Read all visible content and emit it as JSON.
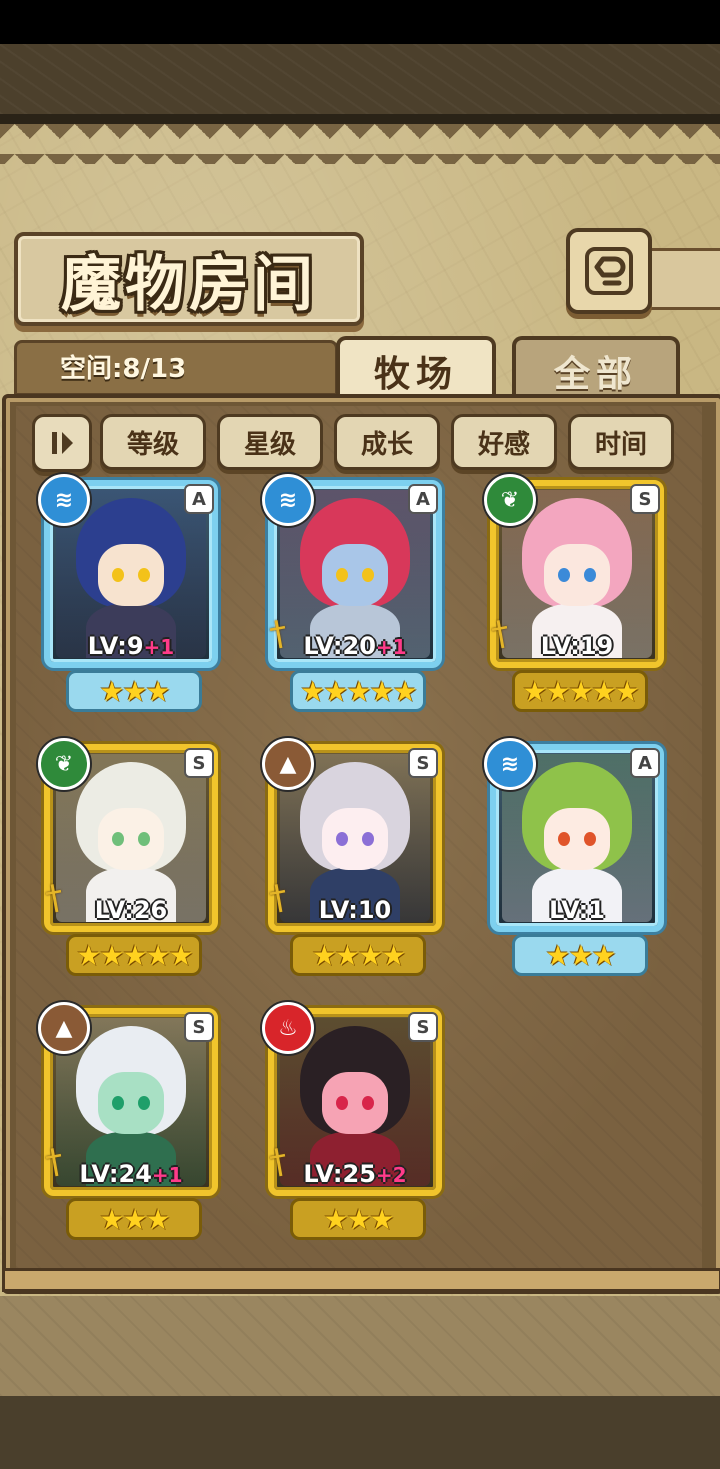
{
  "header": {
    "title": "魔物房间",
    "back_icon": "return-arrow-icon"
  },
  "tabs": {
    "space_label": "空间:8/13",
    "pasture": "牧场",
    "all": "全部",
    "active": "pasture"
  },
  "sort": {
    "toggle_icon": "sort-order-icon",
    "buttons": [
      "等级",
      "星级",
      "成长",
      "好感",
      "时间"
    ]
  },
  "monsters": [
    {
      "element": "water",
      "element_color": "#2f8fd6",
      "rank": "A",
      "frame": "blue",
      "level": "LV:9",
      "bonus": "+1",
      "stars": "★★★",
      "has_weapon": false,
      "hair": "#2c3f8f",
      "skin": "#f7e3cf",
      "outfit": "#3c3c5a",
      "eye": "#f3c21a"
    },
    {
      "element": "water",
      "element_color": "#2f8fd6",
      "rank": "A",
      "frame": "blue",
      "level": "LV:20",
      "bonus": "+1",
      "stars": "★★★★★",
      "has_weapon": true,
      "hair": "#d8385a",
      "skin": "#a9c6e8",
      "outfit": "#b8c6d8",
      "eye": "#f3c21a"
    },
    {
      "element": "leaf",
      "element_color": "#2f8a3a",
      "rank": "S",
      "frame": "gold",
      "level": "LV:19",
      "bonus": "",
      "stars": "★★★★★",
      "has_weapon": true,
      "hair": "#f3a6bf",
      "skin": "#fbe7de",
      "outfit": "#f6f0f0",
      "eye": "#3b8ad8"
    },
    {
      "element": "leaf",
      "element_color": "#2f8a3a",
      "rank": "S",
      "frame": "gold",
      "level": "LV:26",
      "bonus": "",
      "stars": "★★★★★",
      "has_weapon": true,
      "hair": "#ecece4",
      "skin": "#fbf1e6",
      "outfit": "#f2f0ee",
      "eye": "#6fbf7a"
    },
    {
      "element": "earth",
      "element_color": "#8a5a36",
      "rank": "S",
      "frame": "gold",
      "level": "LV:10",
      "bonus": "",
      "stars": "★★★★",
      "has_weapon": true,
      "hair": "#d9d4de",
      "skin": "#fdeef0",
      "outfit": "#2f3f66",
      "eye": "#8b6fd6"
    },
    {
      "element": "water",
      "element_color": "#2f8fd6",
      "rank": "A",
      "frame": "blue",
      "level": "LV:1",
      "bonus": "",
      "stars": "★★★",
      "has_weapon": false,
      "hair": "#8fc24a",
      "skin": "#fdebe2",
      "outfit": "#f2f2f6",
      "eye": "#e0542a"
    },
    {
      "element": "earth",
      "element_color": "#8a5a36",
      "rank": "S",
      "frame": "gold",
      "level": "LV:24",
      "bonus": "+1",
      "stars": "★★★",
      "has_weapon": true,
      "hair": "#e9edf2",
      "skin": "#a8e0c4",
      "outfit": "#2f6f4f",
      "eye": "#1f9f6a"
    },
    {
      "element": "fire",
      "element_color": "#d8252a",
      "rank": "S",
      "frame": "gold",
      "level": "LV:25",
      "bonus": "+2",
      "stars": "★★★",
      "has_weapon": true,
      "hair": "#2a2024",
      "skin": "#f6a3b4",
      "outfit": "#8e2030",
      "eye": "#d8254a"
    }
  ]
}
